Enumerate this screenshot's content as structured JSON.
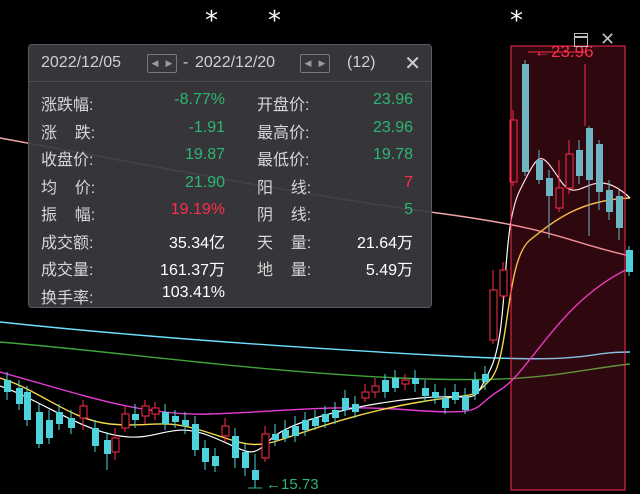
{
  "markers": [
    "*",
    "*",
    "*"
  ],
  "panel": {
    "start_date": "2022/12/05",
    "dash": "-",
    "end_date": "2022/12/20",
    "count": "(12)",
    "close_glyph": "✕",
    "left_rows": [
      {
        "label": "涨跌幅:",
        "value": "-8.77%",
        "color": "green"
      },
      {
        "label": "涨    跌:",
        "value": "-1.91",
        "color": "green"
      },
      {
        "label": "收盘价:",
        "value": "19.87",
        "color": "green"
      },
      {
        "label": "均    价:",
        "value": "21.90",
        "color": "green"
      },
      {
        "label": "振    幅:",
        "value": "19.19%",
        "color": "red"
      },
      {
        "label": "成交额:",
        "value": "35.34亿",
        "color": "white"
      },
      {
        "label": "成交量:",
        "value": "161.37万",
        "color": "white"
      },
      {
        "label": "换手率:",
        "value": "103.41%",
        "color": "white"
      }
    ],
    "right_rows": [
      {
        "label": "开盘价:",
        "value": "23.96",
        "color": "green"
      },
      {
        "label": "最高价:",
        "value": "23.96",
        "color": "green"
      },
      {
        "label": "最低价:",
        "value": "19.78",
        "color": "green"
      },
      {
        "label": "阳    线:",
        "value": "7",
        "color": "red"
      },
      {
        "label": "阴    线:",
        "value": "5",
        "color": "green"
      },
      {
        "label": "天    量:",
        "value": "21.64万",
        "color": "white"
      },
      {
        "label": "地    量:",
        "value": "5.49万",
        "color": "white"
      }
    ]
  },
  "chart": {
    "high_label": "23.96",
    "low_label": "15.73",
    "colors": {
      "up": "#ff2d4b",
      "down": "#4ed3dd",
      "ma5": "#ffffff",
      "ma10": "#f5d84a",
      "ma20": "#e83cd6",
      "ma60": "#6ee0ff",
      "ma120": "#3fa53a",
      "ma250": "#f3a6a6",
      "selection": "#ff2d4b"
    }
  },
  "window_icons": [
    "restore-icon",
    "close-icon"
  ]
}
